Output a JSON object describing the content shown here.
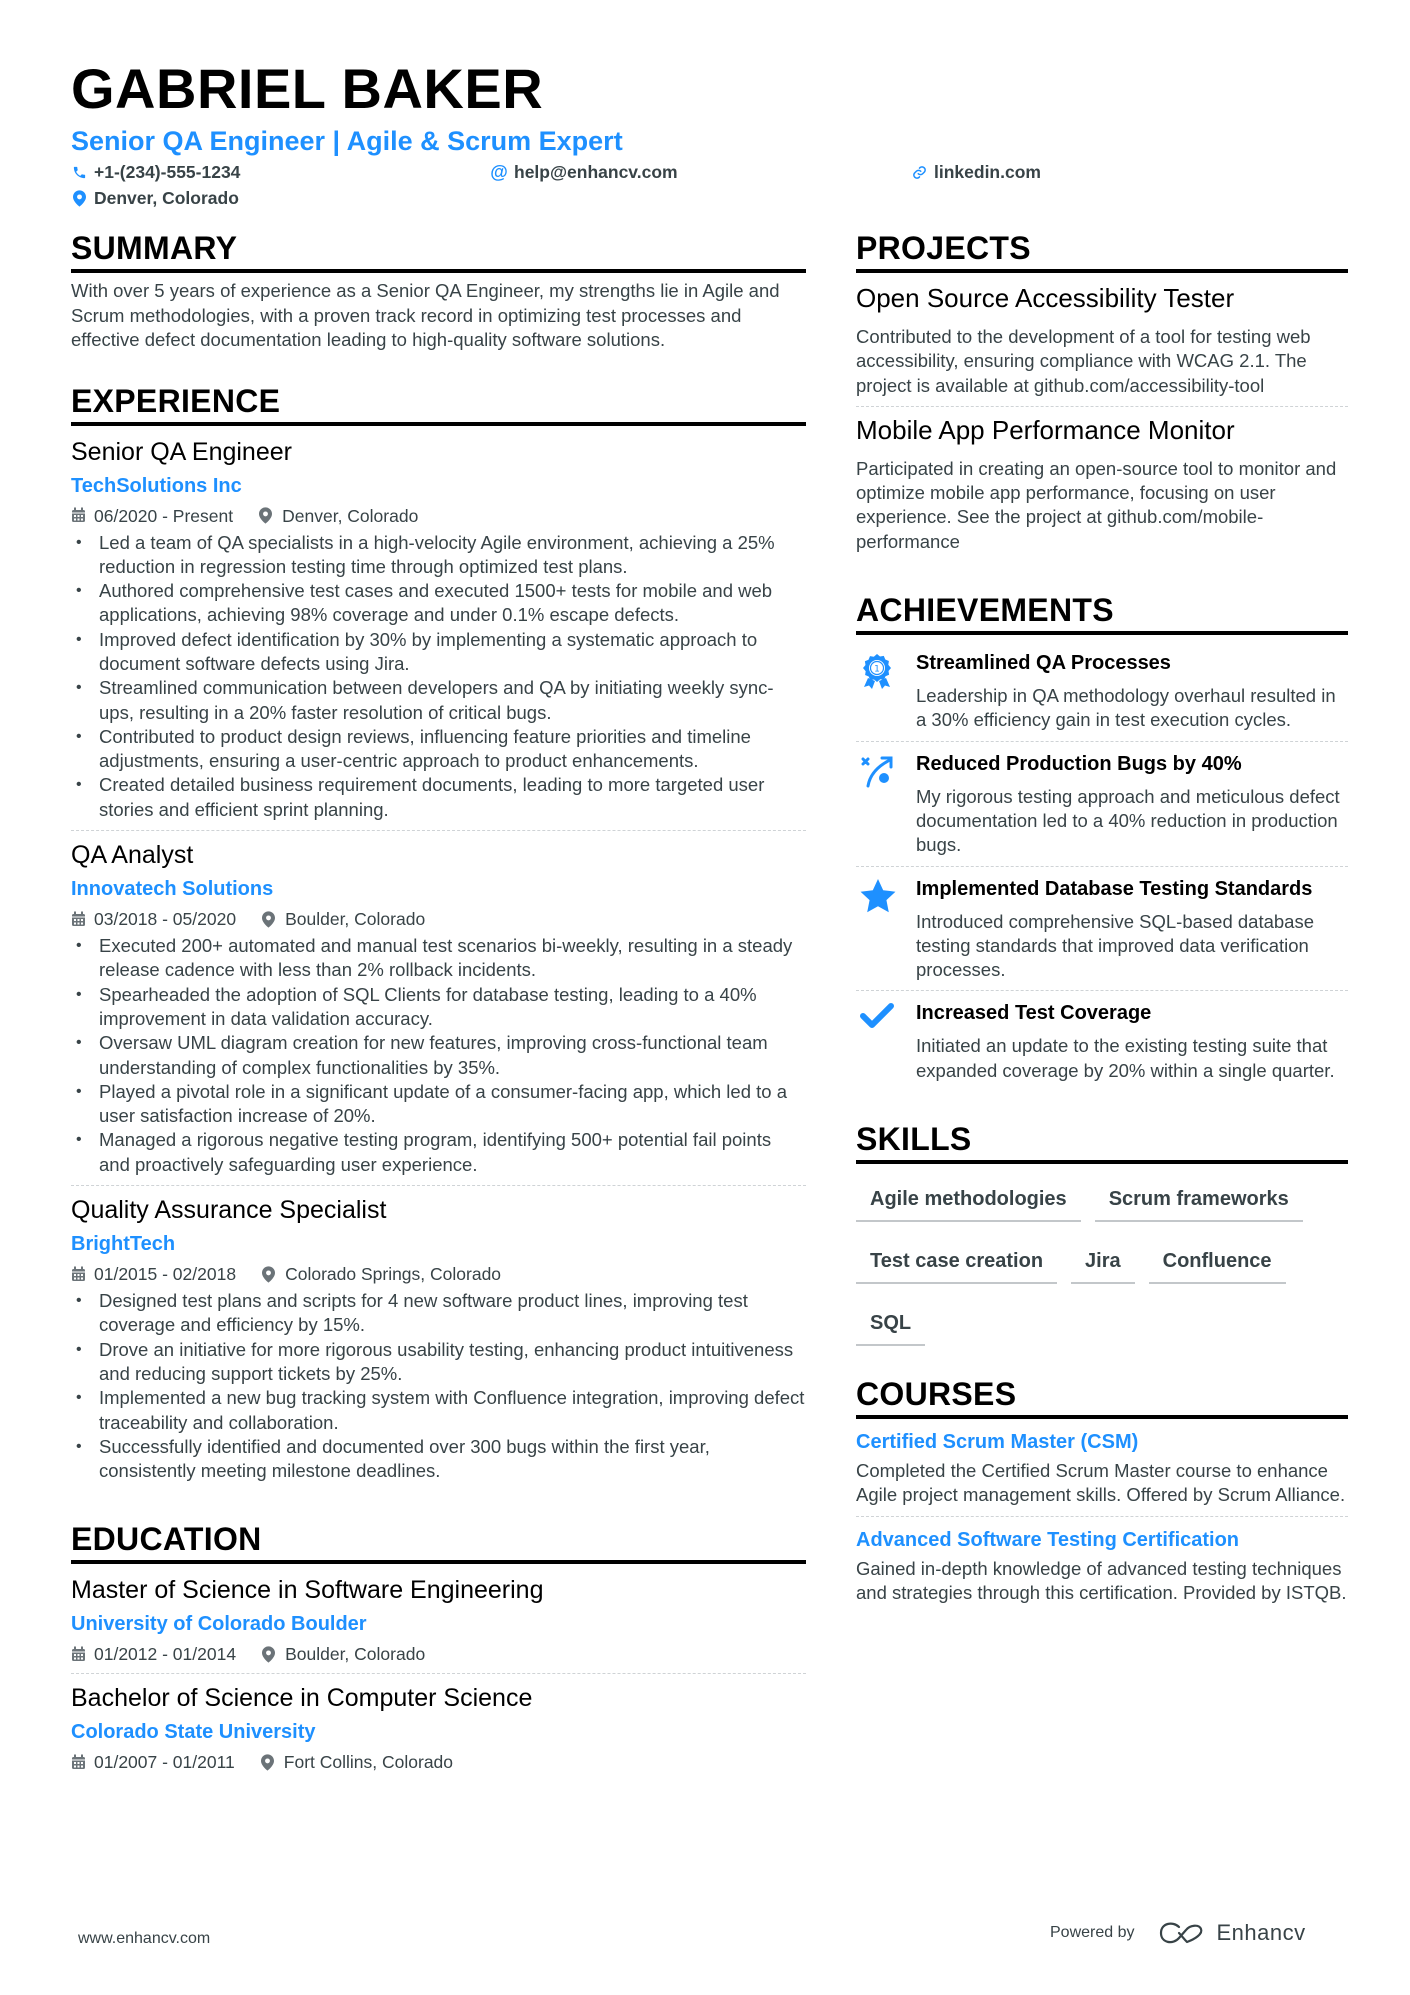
{
  "header": {
    "name": "GABRIEL BAKER",
    "headline": "Senior QA Engineer | Agile & Scrum Expert",
    "phone": "+1-(234)-555-1234",
    "email": "help@enhancv.com",
    "link": "linkedin.com",
    "location": "Denver, Colorado"
  },
  "summary": {
    "title": "SUMMARY",
    "text": "With over 5 years of experience as a Senior QA Engineer, my strengths lie in Agile and Scrum methodologies, with a proven track record in optimizing test processes and effective defect documentation leading to high-quality software solutions."
  },
  "experience": {
    "title": "EXPERIENCE",
    "items": [
      {
        "role": "Senior QA Engineer",
        "company": "TechSolutions Inc",
        "dates": "06/2020 - Present",
        "location": "Denver, Colorado",
        "bullets": [
          "Led a team of QA specialists in a high-velocity Agile environment, achieving a 25% reduction in regression testing time through optimized test plans.",
          "Authored comprehensive test cases and executed 1500+ tests for mobile and web applications, achieving 98% coverage and under 0.1% escape defects.",
          "Improved defect identification by 30% by implementing a systematic approach to document software defects using Jira.",
          "Streamlined communication between developers and QA by initiating weekly sync-ups, resulting in a 20% faster resolution of critical bugs.",
          "Contributed to product design reviews, influencing feature priorities and timeline adjustments, ensuring a user-centric approach to product enhancements.",
          "Created detailed business requirement documents, leading to more targeted user stories and efficient sprint planning."
        ]
      },
      {
        "role": "QA Analyst",
        "company": "Innovatech Solutions",
        "dates": "03/2018 - 05/2020",
        "location": "Boulder, Colorado",
        "bullets": [
          "Executed 200+ automated and manual test scenarios bi-weekly, resulting in a steady release cadence with less than 2% rollback incidents.",
          "Spearheaded the adoption of SQL Clients for database testing, leading to a 40% improvement in data validation accuracy.",
          "Oversaw UML diagram creation for new features, improving cross-functional team understanding of complex functionalities by 35%.",
          "Played a pivotal role in a significant update of a consumer-facing app, which led to a user satisfaction increase of 20%.",
          "Managed a rigorous negative testing program, identifying 500+ potential fail points and proactively safeguarding user experience."
        ]
      },
      {
        "role": "Quality Assurance Specialist",
        "company": "BrightTech",
        "dates": "01/2015 - 02/2018",
        "location": "Colorado Springs, Colorado",
        "bullets": [
          "Designed test plans and scripts for 4 new software product lines, improving test coverage and efficiency by 15%.",
          "Drove an initiative for more rigorous usability testing, enhancing product intuitiveness and reducing support tickets by 25%.",
          "Implemented a new bug tracking system with Confluence integration, improving defect traceability and collaboration.",
          "Successfully identified and documented over 300 bugs within the first year, consistently meeting milestone deadlines."
        ]
      }
    ]
  },
  "education": {
    "title": "EDUCATION",
    "items": [
      {
        "degree": "Master of Science in Software Engineering",
        "school": "University of Colorado Boulder",
        "dates": "01/2012 - 01/2014",
        "location": "Boulder, Colorado"
      },
      {
        "degree": "Bachelor of Science in Computer Science",
        "school": "Colorado State University",
        "dates": "01/2007 - 01/2011",
        "location": "Fort Collins, Colorado"
      }
    ]
  },
  "projects": {
    "title": "PROJECTS",
    "items": [
      {
        "name": "Open Source Accessibility Tester",
        "description": "Contributed to the development of a tool for testing web accessibility, ensuring compliance with WCAG 2.1. The project is available at github.com/accessibility-tool"
      },
      {
        "name": "Mobile App Performance Monitor",
        "description": "Participated in creating an open-source tool to monitor and optimize mobile app performance, focusing on user experience. See the project at github.com/mobile-performance"
      }
    ]
  },
  "achievements": {
    "title": "ACHIEVEMENTS",
    "items": [
      {
        "icon": "award-ribbon-icon",
        "title": "Streamlined QA Processes",
        "description": "Leadership in QA methodology overhaul resulted in a 30% efficiency gain in test execution cycles."
      },
      {
        "icon": "strategy-arrow-icon",
        "title": "Reduced Production Bugs by 40%",
        "description": "My rigorous testing approach and meticulous defect documentation led to a 40% reduction in production bugs."
      },
      {
        "icon": "star-icon",
        "title": "Implemented Database Testing Standards",
        "description": "Introduced comprehensive SQL-based database testing standards that improved data verification processes."
      },
      {
        "icon": "checkmark-icon",
        "title": "Increased Test Coverage",
        "description": "Initiated an update to the existing testing suite that expanded coverage by 20% within a single quarter."
      }
    ]
  },
  "skills": {
    "title": "SKILLS",
    "items": [
      "Agile methodologies",
      "Scrum frameworks",
      "Test case creation",
      "Jira",
      "Confluence",
      "SQL"
    ]
  },
  "courses": {
    "title": "COURSES",
    "items": [
      {
        "name": "Certified Scrum Master (CSM)",
        "description": "Completed the Certified Scrum Master course to enhance Agile project management skills. Offered by Scrum Alliance."
      },
      {
        "name": "Advanced Software Testing Certification",
        "description": "Gained in-depth knowledge of advanced testing techniques and strategies through this certification. Provided by ISTQB."
      }
    ]
  },
  "footer": {
    "website": "www.enhancv.com",
    "powered_by": "Powered by",
    "brand": "Enhancv"
  },
  "colors": {
    "accent": "#1e90ff",
    "text": "#384347",
    "heading": "#000000"
  }
}
